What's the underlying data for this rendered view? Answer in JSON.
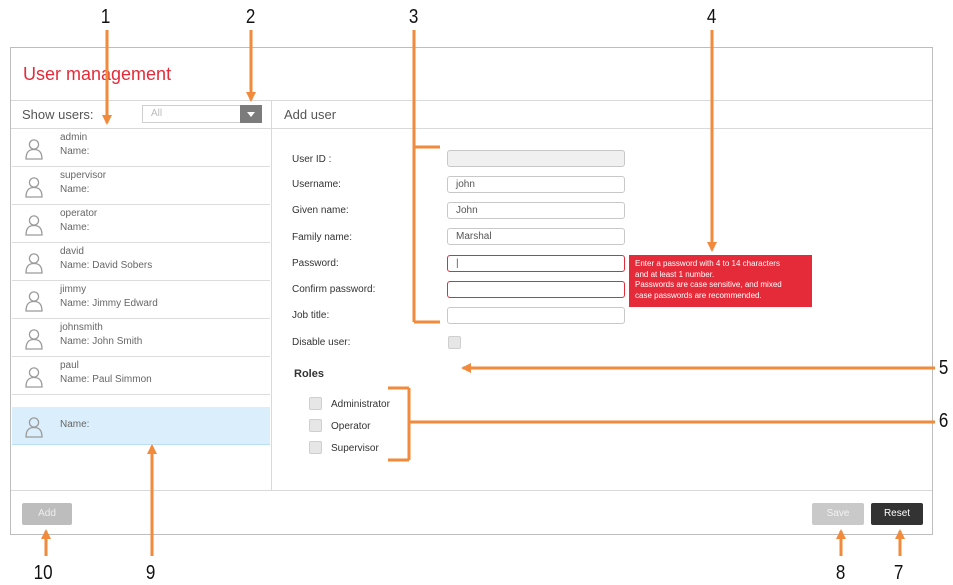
{
  "callouts": [
    "1",
    "2",
    "3",
    "4",
    "5",
    "6",
    "7",
    "8",
    "9",
    "10"
  ],
  "colors": {
    "accent": "#e52a39",
    "callout": "#f28a3c",
    "selection": "#daeefb",
    "button_dark": "#333333"
  },
  "app": {
    "title": "User management"
  },
  "filter": {
    "label": "Show users:",
    "value": "All"
  },
  "panel_title": "Add user",
  "users": [
    {
      "username": "admin",
      "name": "Name:"
    },
    {
      "username": "supervisor",
      "name": "Name:"
    },
    {
      "username": "operator",
      "name": "Name:"
    },
    {
      "username": "david",
      "name": "Name: David Sobers"
    },
    {
      "username": "jimmy",
      "name": "Name: Jimmy Edward"
    },
    {
      "username": "johnsmith",
      "name": "Name: John Smith"
    },
    {
      "username": "paul",
      "name": "Name: Paul Simmon"
    },
    {
      "username": "",
      "name": "Name:"
    }
  ],
  "form": {
    "user_id": {
      "label": "User ID :",
      "value": ""
    },
    "username": {
      "label": "Username:",
      "value": "john"
    },
    "given_name": {
      "label": "Given name:",
      "value": "John"
    },
    "family_name": {
      "label": "Family name:",
      "value": "Marshal"
    },
    "password": {
      "label": "Password:",
      "value": "|"
    },
    "confirm_password": {
      "label": "Confirm password:",
      "value": ""
    },
    "job_title": {
      "label": "Job title:",
      "value": ""
    },
    "disable_user": {
      "label": "Disable user:"
    }
  },
  "tooltip": {
    "line1": "Enter a password with 4 to 14 characters",
    "line2": "and at least 1 number.",
    "line3": "Passwords are case sensitive, and mixed",
    "line4": "case passwords are recommended."
  },
  "roles": {
    "heading": "Roles",
    "items": [
      "Administrator",
      "Operator",
      "Supervisor"
    ]
  },
  "buttons": {
    "add": "Add",
    "save": "Save",
    "reset": "Reset"
  }
}
